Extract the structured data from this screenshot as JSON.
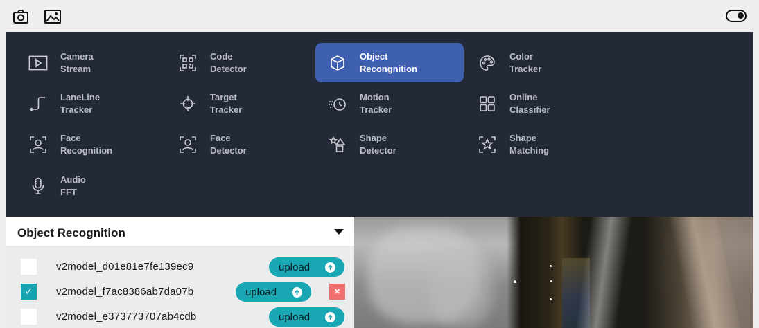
{
  "toolbar": {
    "camera_icon": "camera-icon",
    "image_icon": "image-icon",
    "toggle_icon": "toggle-icon"
  },
  "menu": {
    "items": [
      {
        "label": "Camera\nStream",
        "icon": "play-box-icon"
      },
      {
        "label": "Code\nDetector",
        "icon": "qr-code-icon"
      },
      {
        "label": "Object\nRecongnition",
        "icon": "cube-icon",
        "active": true
      },
      {
        "label": "Color\nTracker",
        "icon": "palette-icon"
      },
      {
        "label": "LaneLine\nTracker",
        "icon": "lane-line-icon"
      },
      {
        "label": "Target\nTracker",
        "icon": "crosshair-icon"
      },
      {
        "label": "Motion\nTracker",
        "icon": "motion-icon"
      },
      {
        "label": "Online\nClassifier",
        "icon": "grid-squares-icon"
      },
      {
        "label": "Face\nRecognition",
        "icon": "face-scan-icon"
      },
      {
        "label": "Face\nDetector",
        "icon": "face-frame-icon"
      },
      {
        "label": "Shape\nDetector",
        "icon": "shapes-icon"
      },
      {
        "label": "Shape\nMatching",
        "icon": "star-frame-icon"
      },
      {
        "label": "Audio\nFFT",
        "icon": "microphone-icon"
      }
    ]
  },
  "panel": {
    "title": "Object Recognition",
    "models": [
      {
        "name": "v2model_d01e81e7fe139ec9",
        "checked": false,
        "button": "upload"
      },
      {
        "name": "v2model_f7ac8386ab7da07b",
        "checked": true,
        "button": "upload",
        "delete": "×"
      },
      {
        "name": "v2model_e373773707ab4cdb",
        "checked": false,
        "button": "upload"
      }
    ],
    "check_mark": "✓"
  },
  "colors": {
    "menu_bg": "#232936",
    "active_item": "#3f5fb0",
    "upload_button": "#1aa7b4",
    "checkbox_on": "#17a2b0",
    "delete_button": "#f07070"
  }
}
